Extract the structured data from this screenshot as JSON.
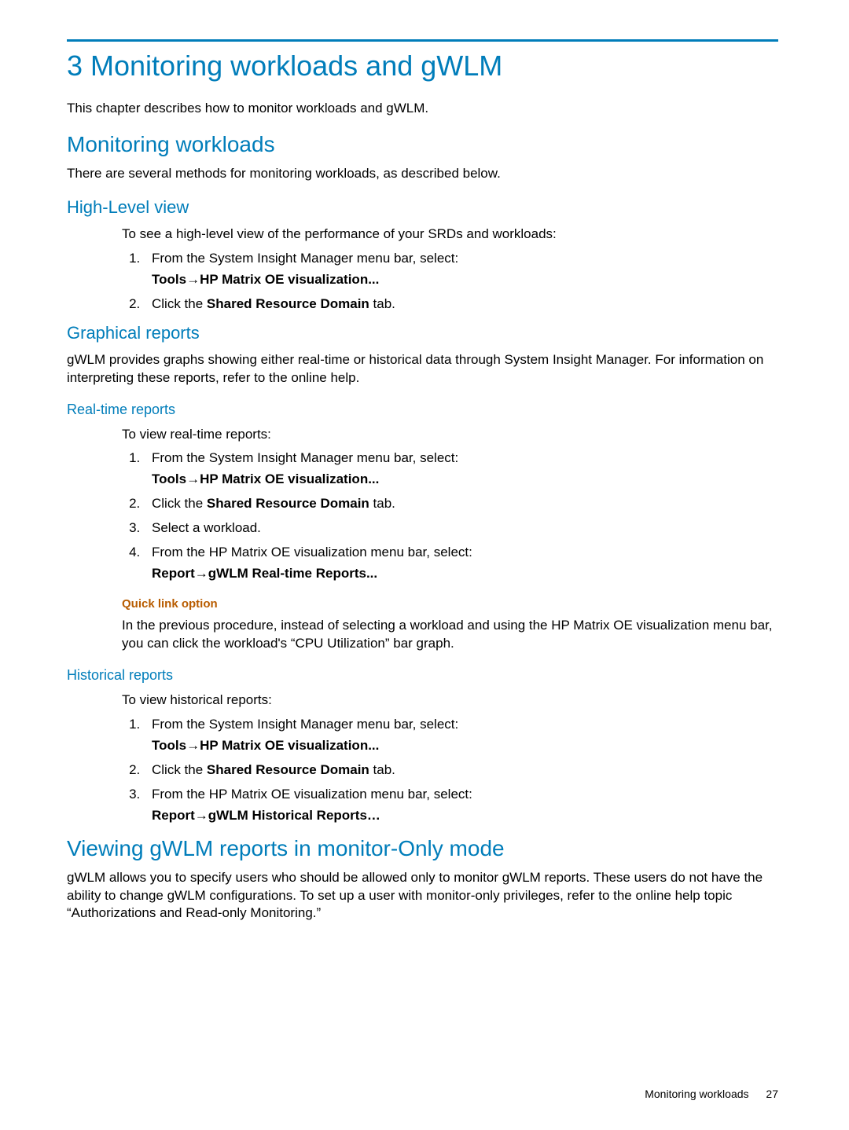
{
  "title": "3 Monitoring workloads and gWLM",
  "intro": "This chapter describes how to monitor workloads and gWLM.",
  "s1": {
    "heading": "Monitoring workloads",
    "text": "There are several methods for monitoring workloads, as described below."
  },
  "s2": {
    "heading": "High-Level view",
    "lead": "To see a high-level view of the performance of your SRDs and workloads:",
    "step1": "From the System Insight Manager menu bar, select:",
    "step1_path": "Tools→HP Matrix OE visualization...",
    "step2_a": "Click the ",
    "step2_b": "Shared Resource Domain",
    "step2_c": " tab."
  },
  "s3": {
    "heading": "Graphical reports",
    "text": "gWLM provides graphs showing either real-time or historical data through System Insight Manager. For information on interpreting these reports, refer to the online help."
  },
  "s4": {
    "heading": "Real-time reports",
    "lead": "To view real-time reports:",
    "step1": "From the System Insight Manager menu bar, select:",
    "step1_path": "Tools→HP Matrix OE visualization...",
    "step2_a": "Click the ",
    "step2_b": "Shared Resource Domain",
    "step2_c": " tab.",
    "step3": "Select a workload.",
    "step4": "From the HP Matrix OE visualization menu bar, select:",
    "step4_path": "Report→gWLM Real-time Reports...",
    "quick_heading": "Quick link option",
    "quick_text": "In the previous procedure, instead of selecting a workload and using the HP Matrix OE visualization menu bar, you can click the workload's “CPU Utilization” bar graph."
  },
  "s5": {
    "heading": "Historical reports",
    "lead": "To view historical reports:",
    "step1": "From the System Insight Manager menu bar, select:",
    "step1_path": "Tools→HP Matrix OE visualization...",
    "step2_a": "Click the ",
    "step2_b": "Shared Resource Domain",
    "step2_c": " tab.",
    "step3": "From the HP Matrix OE visualization menu bar, select:",
    "step3_path": "Report→gWLM Historical Reports…"
  },
  "s6": {
    "heading": "Viewing gWLM reports in monitor-Only mode",
    "text": "gWLM allows you to specify users who should be allowed only to monitor gWLM reports. These users do not have the ability to change gWLM configurations. To set up a user with monitor-only privileges, refer to the online help topic “Authorizations and Read-only Monitoring.”"
  },
  "footer": {
    "label": "Monitoring workloads",
    "page": "27"
  }
}
